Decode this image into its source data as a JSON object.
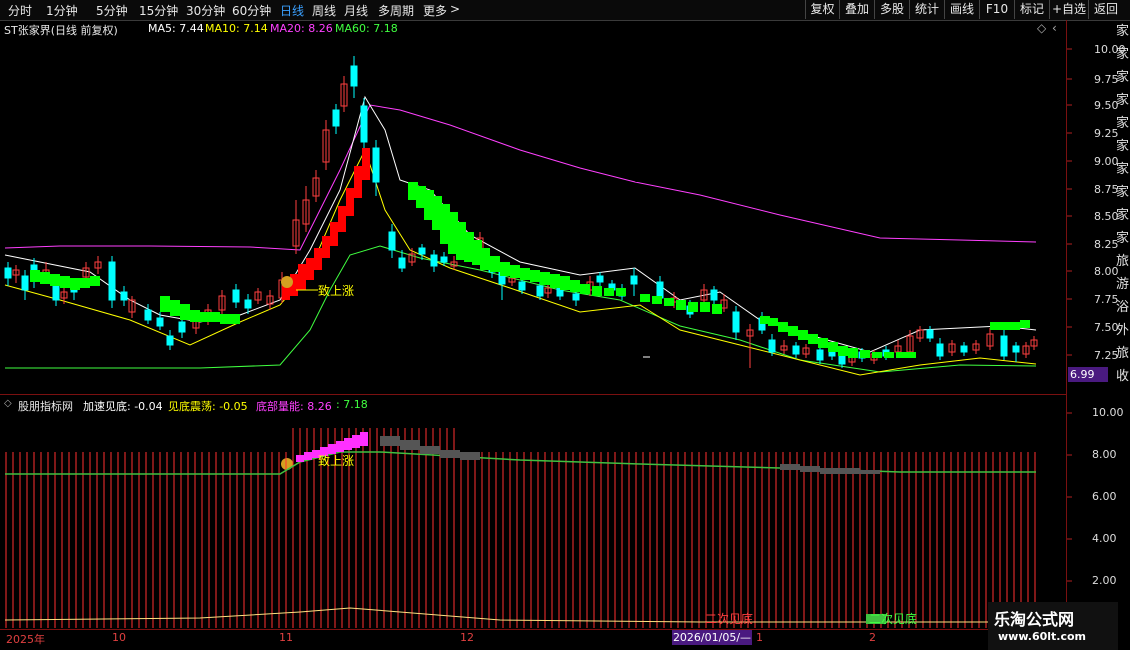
{
  "toolbar": {
    "periods": [
      "分时",
      "1分钟",
      "5分钟",
      "15分钟",
      "30分钟",
      "60分钟",
      "日线",
      "周线",
      "月线",
      "多周期",
      "更多"
    ],
    "active_period": "日线",
    "more_arrow": ">",
    "right_buttons": [
      "复权",
      "叠加",
      "多股",
      "统计",
      "画线",
      "F10",
      "标记",
      "+自选",
      "返回"
    ]
  },
  "main_panel": {
    "title": "ST张家界(日线 前复权)",
    "ma5": "MA5: 7.44",
    "ma10": "MA10: 7.14",
    "ma20": "MA20: 8.26",
    "ma60": "MA60: 7.18",
    "annotation": "致上涨",
    "current_price": "6.99",
    "yticks": [
      "10.00",
      "9.75",
      "9.50",
      "9.25",
      "9.00",
      "8.75",
      "8.50",
      "8.25",
      "8.00",
      "7.75",
      "7.50",
      "7.25"
    ]
  },
  "sub_panel": {
    "indicator": "股朋指标网",
    "accel": "加速见底: -0.04",
    "osc": "见底震荡: -0.05",
    "bottom": "底部量能: 8.26",
    "bottom2": ": 7.18",
    "annotation": "致上涨",
    "second_bottom_1": "二次见底",
    "second_bottom_2": "二次见底",
    "yticks": [
      "10.00",
      "8.00",
      "6.00",
      "4.00",
      "2.00"
    ]
  },
  "xaxis": {
    "labels": [
      "2025年",
      "10",
      "11",
      "12",
      "1",
      "2"
    ],
    "cursor_date": "2026/01/05/—"
  },
  "side_strip": {
    "chars": [
      "家",
      "家",
      "家",
      "家",
      "家",
      "家",
      "家",
      "家",
      "家",
      "家",
      "旅",
      "游",
      "浴",
      "外",
      "旅",
      "收"
    ]
  },
  "watermark": {
    "line1": "乐淘公式网",
    "line2": "www.60lt.com"
  },
  "colors": {
    "up": "#ff4040",
    "down": "#00ffff",
    "ma5": "#ffffff",
    "ma10": "#ffff00",
    "ma20": "#ff40ff",
    "ma60": "#40ff40",
    "grid": "#7a1010"
  }
}
